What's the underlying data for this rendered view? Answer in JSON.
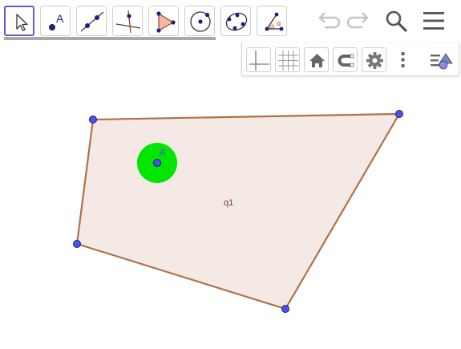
{
  "toolbar": {
    "tools": [
      {
        "id": "move",
        "icon": "arrow-cursor-icon",
        "selected": true
      },
      {
        "id": "point",
        "icon": "point-icon",
        "label": "A"
      },
      {
        "id": "line",
        "icon": "line-icon"
      },
      {
        "id": "perpendicular",
        "icon": "perpendicular-line-icon"
      },
      {
        "id": "polygon",
        "icon": "polygon-icon"
      },
      {
        "id": "circle",
        "icon": "circle-center-point-icon"
      },
      {
        "id": "conic",
        "icon": "conic-five-points-icon"
      },
      {
        "id": "angle",
        "icon": "angle-icon",
        "label": "α"
      }
    ],
    "actions": [
      "undo-icon",
      "redo-icon",
      "search-icon",
      "menu-icon"
    ]
  },
  "style_panel": {
    "buttons": [
      "axes-icon",
      "grid-icon",
      "home-icon",
      "magnet-icon",
      "gear-icon",
      "more-vert-icon",
      "style-bar-toggle-icon"
    ]
  },
  "canvas": {
    "point_label": "A",
    "polygon_label": "q1",
    "colors": {
      "polygon_fill": "#f4e9e5",
      "polygon_stroke": "#b0704a",
      "vertex": "#4f50f0",
      "disc": "#00e600",
      "accent": "#6557d2"
    }
  }
}
